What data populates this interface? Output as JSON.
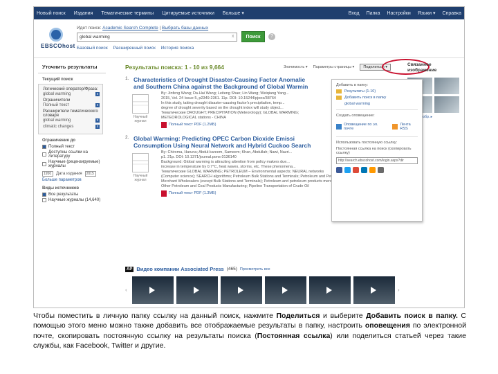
{
  "topbar": {
    "links": [
      "Новый поиск",
      "Издания",
      "Тематические термины",
      "Цитируемые источники",
      "Больше ▾"
    ],
    "right": [
      "Вход",
      "Папка",
      "Настройки",
      "Языки ▾",
      "Справка"
    ]
  },
  "search": {
    "logo": "EBSCOhost",
    "searching_label": "Идет поиск:",
    "database": "Academic Search Complete",
    "choose_db": "Выбрать базы данных",
    "query": "global warming",
    "clear": "x",
    "button": "Поиск",
    "help": "?",
    "links": [
      "Базовый поиск",
      "Расширенный поиск",
      "История поиска"
    ]
  },
  "left": {
    "header": "Уточнить результаты",
    "current_search": "Текущий поиск",
    "boolean_label": "Логический оператор/Фраза:",
    "boolean_value": "global warming",
    "limiters_label": "Ограничители",
    "fulltext": "Полный текст",
    "expanders_label": "Расширители тематического словаря",
    "facet_values": [
      "global warming",
      "climatic changes"
    ],
    "limit_header": "Ограничение до",
    "options": [
      "Полный текст",
      "Доступны ссылки на литературу",
      "Научные (рецензируемые) журналы"
    ],
    "date_from": "1950",
    "date_label": "Дата издания",
    "date_to": "2015",
    "more_options": "Больше параметров",
    "sources_header": "Виды источников",
    "sources": [
      "Все результаты",
      "Научные журналы (14,640)"
    ]
  },
  "main": {
    "results_title": "Результаты поиска: 1 - 10 из 9,664",
    "sort": "Значимость ▾",
    "page_options": "Параметры страницы ▾",
    "share": "Поделиться ▾",
    "results": [
      {
        "num": "1.",
        "title_lines": [
          "Characteristics of Drought Disaster-Causing Factor Anomalie",
          "and Southern China against the Background of Global Warmin"
        ],
        "thumb": "Научный журнал",
        "meta": [
          "By: Jinfeng Wang; Da-Hai Wang; Leiteng Shao; Lin Wang; Weiqiang Yang...",
          "2015, Vol. 24 Issue 5, p2349-2361. 11p. DOI: 10.15244/pjoes/38764",
          "In this study, taking drought disaster-causing factor's precipitation, temp...",
          "degree of drought severity based on the drought index will study object...",
          "Тематические DROUGHT; PRECIPITATION (Meteorology); GLOBAL WARMING;",
          "METEOROLOGICAL stations - CHINA"
        ],
        "pdf": "Полный текст PDF (1.2МБ)"
      },
      {
        "num": "2.",
        "title_lines": [
          "Global Warming: Predicting OPEC Carbon Dioxide Emissi",
          "Consumption Using Neural Network and Hybrid Cuckoo Search"
        ],
        "thumb": "Научный журнал",
        "meta": [
          "By: Chiroma, Haruna; Abdul-kareem, Sameem; Khan, Abdullah; Nawi, Nazri...",
          "p1. 21p. DOI: 10.1371/journal.pone.0136140",
          "Background: Global warming is attracting attention from policy makers due...",
          "increase in temperature by 0.7°C, heat waves, storms, etc. These phenomena...",
          "Тематические GLOBAL WARMING; PETROLEUM – Environmental aspects; NEURAL networks",
          "(Computer science); SEARCH algorithms; Petroleum Bulk Stations and Terminals; Petroleum and Petroleum Products",
          "Merchant Wholesalers (except Bulk Stations and Terminals); Petroleum and petroleum products merchant wholesalers;",
          "Other Petroleum and Coal Products Manufacturing; Pipeline Transportation of Crude Oil"
        ],
        "pdf": "Полный текст PDF (1.3МБ)"
      }
    ]
  },
  "video": {
    "brand": "AP",
    "title": "Видео компании Associated Press",
    "count": "(465)",
    "preview": "Просмотреть все"
  },
  "rail": {
    "title": "Связанное изображение",
    "more": "Другие изобр. ▸"
  },
  "share_menu": {
    "add_to_folder": "Добавить в папку:",
    "results_item": "Результаты (1-10)",
    "add_search": "Добавить поиск в папку",
    "search_term": "global warming",
    "create_alert": "Создать оповещение:",
    "email_alert": "Оповещение по эл. почте",
    "rss": "Лента RSS",
    "permalink_label": "Использовать постоянную ссылку:",
    "permalink_sub": "Постоянная ссылка на поиск (скопировать ссылку)",
    "permalink_value": "http://search.ebscohost.com/login.aspx?dir"
  },
  "caption": {
    "part1": "Чтобы поместить в личную папку ссылку на данный поиск, нажмите ",
    "bold1": "Поделиться",
    "part2": " и выберите ",
    "bold2": "Добавить поиск в папку.",
    "part3": " С помощью этого меню можно также добавить все отображаемые результаты в папку, настроить ",
    "bold3": "оповещения",
    "part4": " по электронной почте, скопировать постоянную ссылку на результаты поиска (",
    "bold4": "Постоянная ссылка",
    "part5": ") или поделиться статьей через такие службы, как Facebook, Twitter и другие."
  },
  "colors": {
    "topbar": "#1f3f6e",
    "link": "#2b5c9e",
    "search_button": "#3d9a3a",
    "results_title": "#6a8a2a",
    "highlight_ring": "#c8102e"
  }
}
